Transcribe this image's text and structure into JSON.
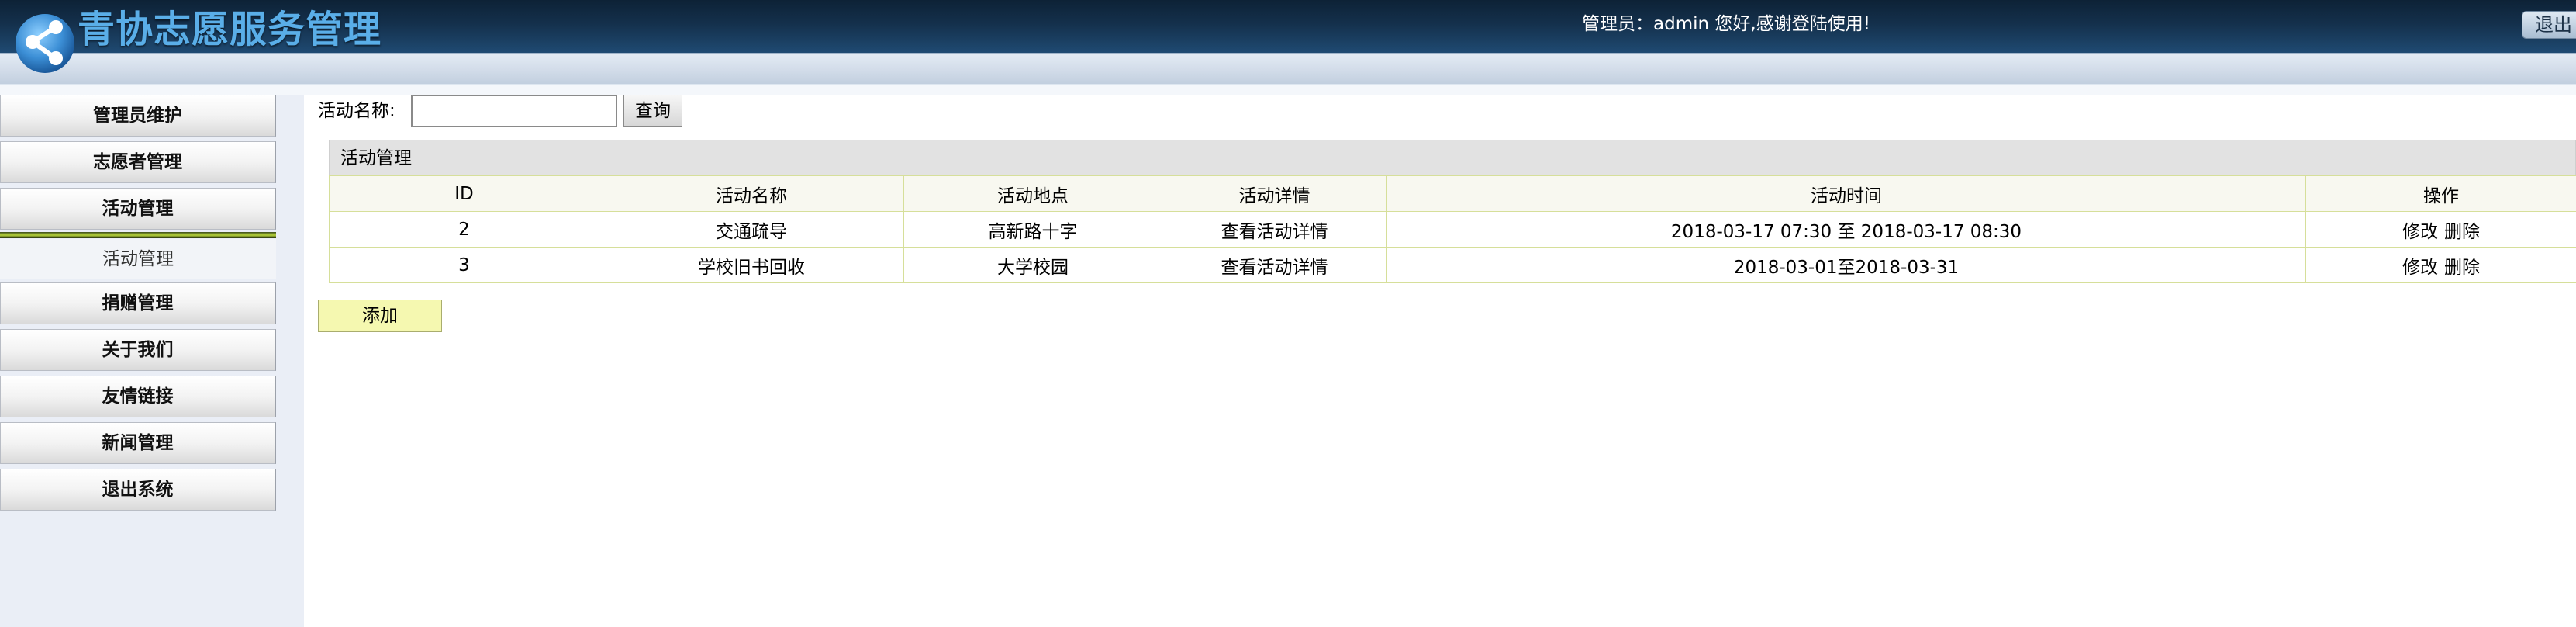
{
  "header": {
    "title": "青协志愿服务管理",
    "greeting": "管理员：admin 您好,感谢登陆使用!",
    "logout_label": "退出"
  },
  "sidebar": {
    "items": [
      {
        "label": "管理员维护"
      },
      {
        "label": "志愿者管理"
      },
      {
        "label": "活动管理"
      },
      {
        "label": "捐赠管理"
      },
      {
        "label": "关于我们"
      },
      {
        "label": "友情链接"
      },
      {
        "label": "新闻管理"
      },
      {
        "label": "退出系统"
      }
    ],
    "active_submenu": "活动管理"
  },
  "search": {
    "label": "活动名称:",
    "value": "",
    "button_label": "查询"
  },
  "panel": {
    "title": "活动管理",
    "columns": [
      "ID",
      "活动名称",
      "活动地点",
      "活动详情",
      "活动时间",
      "操作"
    ],
    "rows": [
      {
        "id": "2",
        "name": "交通疏导",
        "location": "高新路十字",
        "details": "查看活动详情",
        "time": "2018-03-17 07:30 至 2018-03-17 08:30",
        "edit": "修改",
        "delete": "删除"
      },
      {
        "id": "3",
        "name": "学校旧书回收",
        "location": "大学校园",
        "details": "查看活动详情",
        "time": "2018-03-01至2018-03-31",
        "edit": "修改",
        "delete": "删除"
      }
    ]
  },
  "add_button_label": "添加",
  "colors": {
    "header_dark": "#14304c",
    "title_blue": "#5aaee8",
    "table_border": "#d6df9a",
    "add_button_bg": "#f5f8b0",
    "active_bar": "#b8d53a"
  }
}
